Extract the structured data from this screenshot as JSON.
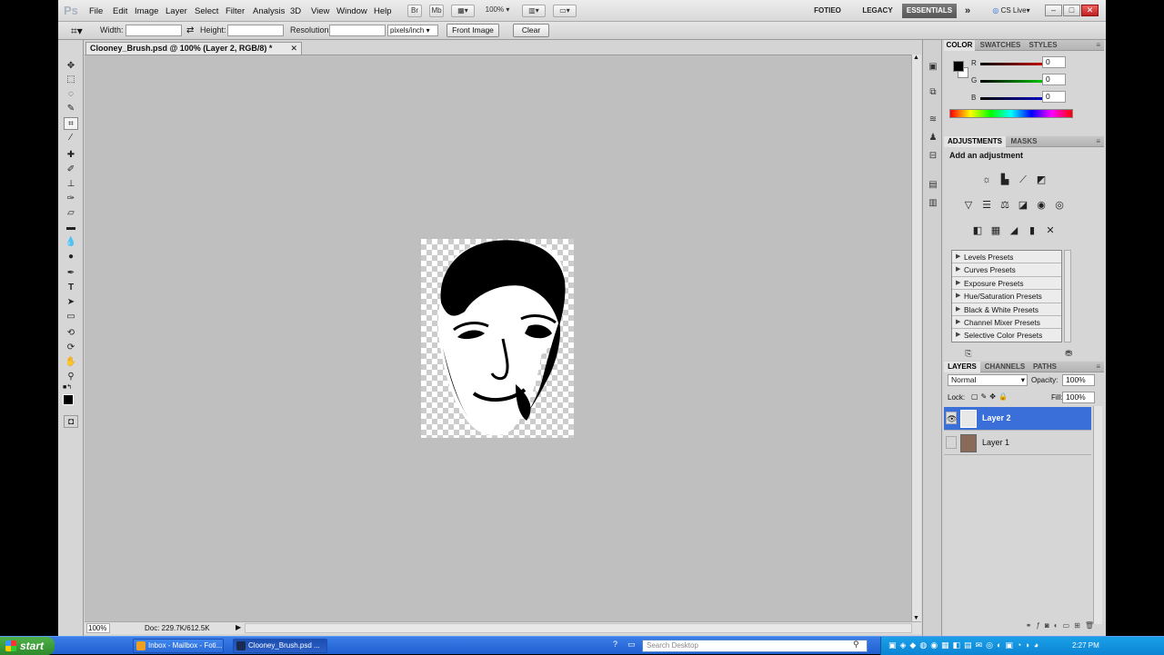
{
  "app": {
    "logo": "Ps",
    "menus": [
      "File",
      "Edit",
      "Image",
      "Layer",
      "Select",
      "Filter",
      "Analysis",
      "3D",
      "View",
      "Window",
      "Help"
    ],
    "header_buttons": {
      "bridge": "Br",
      "mini": "Mb",
      "zoom": "100%"
    },
    "workspaces": [
      "FOTIEO",
      "LEGACY",
      "ESSENTIALS"
    ],
    "cs_live": "CS Live"
  },
  "options_bar": {
    "width_label": "Width:",
    "height_label": "Height:",
    "resolution_label": "Resolution:",
    "width_value": "",
    "height_value": "",
    "resolution_value": "",
    "units": "pixels/inch",
    "front_image": "Front Image",
    "clear": "Clear"
  },
  "document": {
    "tab_title": "Clooney_Brush.psd @ 100% (Layer 2, RGB/8) *",
    "zoom": "100%",
    "doc_size": "Doc: 229.7K/612.5K"
  },
  "color_panel": {
    "tabs": [
      "COLOR",
      "SWATCHES",
      "STYLES"
    ],
    "r": {
      "label": "R",
      "value": "0"
    },
    "g": {
      "label": "G",
      "value": "0"
    },
    "b": {
      "label": "B",
      "value": "0"
    }
  },
  "adjustments_panel": {
    "tabs": [
      "ADJUSTMENTS",
      "MASKS"
    ],
    "heading": "Add an adjustment",
    "presets": [
      "Levels Presets",
      "Curves Presets",
      "Exposure Presets",
      "Hue/Saturation Presets",
      "Black & White Presets",
      "Channel Mixer Presets",
      "Selective Color Presets"
    ]
  },
  "layers_panel": {
    "tabs": [
      "LAYERS",
      "CHANNELS",
      "PATHS"
    ],
    "blend_mode": "Normal",
    "opacity_label": "Opacity:",
    "opacity": "100%",
    "lock_label": "Lock:",
    "fill_label": "Fill:",
    "fill": "100%",
    "layers": [
      {
        "name": "Layer 2",
        "selected": true
      },
      {
        "name": "Layer 1",
        "selected": false
      }
    ]
  },
  "taskbar": {
    "start": "start",
    "items": [
      "Inbox - Mailbox - Foti...",
      "Clooney_Brush.psd ..."
    ],
    "search_placeholder": "Search Desktop",
    "time": "2:27 PM"
  },
  "colors": {
    "accent": "#2c5fd0",
    "selected_layer": "#3a6ed8",
    "canvas_bg": "#bfbfbf"
  }
}
